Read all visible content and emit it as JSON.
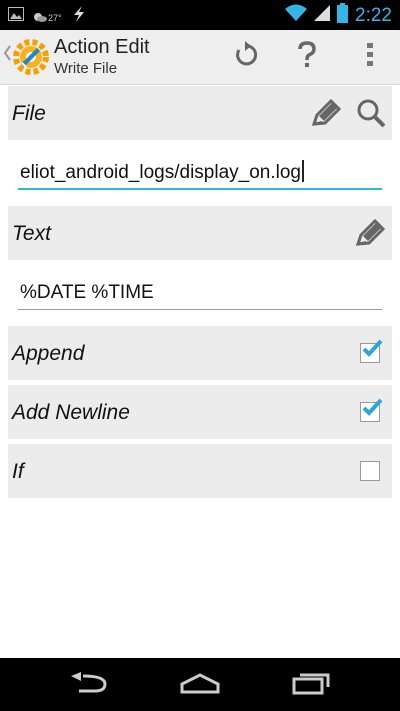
{
  "status_bar": {
    "time": "2:22",
    "weather_temp": "27°",
    "icons": [
      "gallery-icon",
      "weather-icon",
      "bolt-icon",
      "wifi-icon",
      "signal-icon",
      "battery-icon"
    ]
  },
  "action_bar": {
    "title": "Action Edit",
    "subtitle": "Write File",
    "icons": [
      "up-chevron-icon",
      "tasker-logo-icon",
      "revert-icon",
      "help-icon",
      "overflow-menu-icon"
    ]
  },
  "form": {
    "file": {
      "label": "File",
      "value": "eliot_android_logs/display_on.log",
      "icons": [
        "edit-pencil-icon",
        "search-icon"
      ]
    },
    "text": {
      "label": "Text",
      "value": "%DATE %TIME",
      "icons": [
        "edit-pencil-icon"
      ]
    },
    "append": {
      "label": "Append",
      "checked": true
    },
    "add_newline": {
      "label": "Add Newline",
      "checked": true
    },
    "if": {
      "label": "If",
      "checked": false
    }
  },
  "nav_bar": {
    "icons": [
      "back-icon",
      "home-icon",
      "recent-apps-icon"
    ]
  },
  "colors": {
    "accent": "#33b5e5",
    "row_background": "#ececec",
    "checkmark": "#2aa6dd"
  }
}
